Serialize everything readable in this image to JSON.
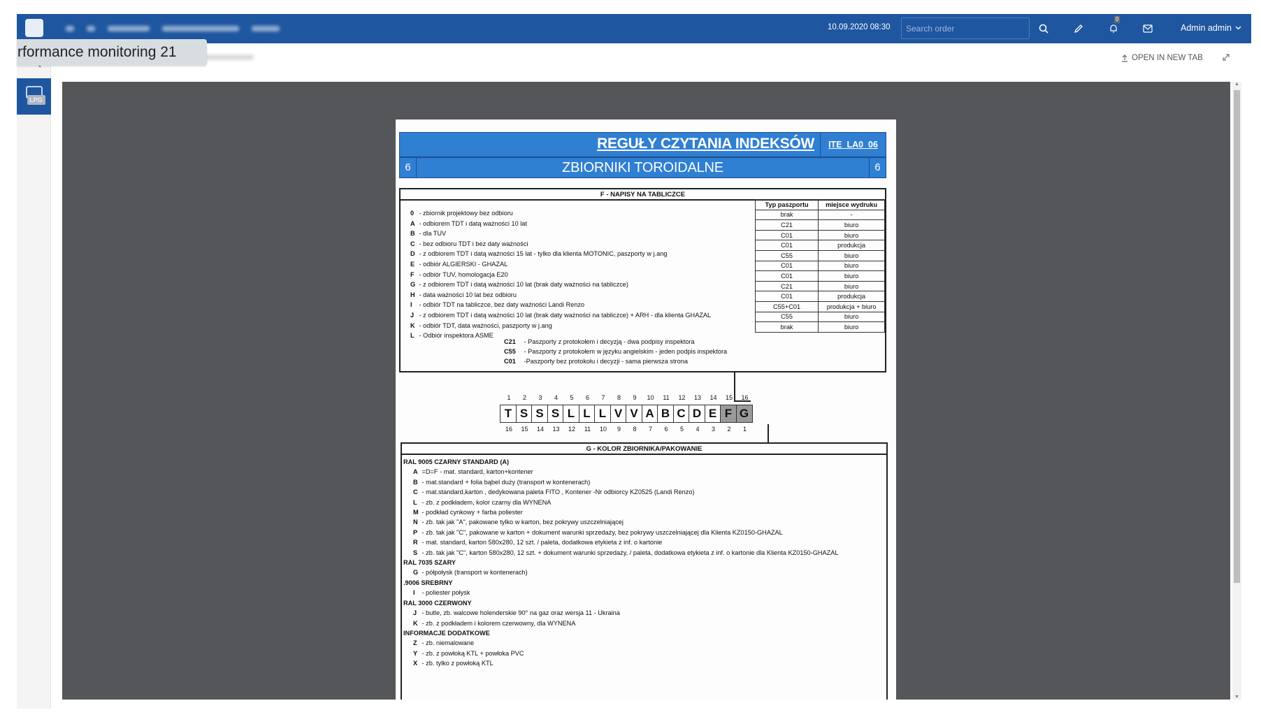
{
  "tooltip": {
    "text": "rformance monitoring 21"
  },
  "topbar": {
    "datetime": "10.09.2020 08:30",
    "search_placeholder": "Search order",
    "notification_count": "0",
    "user_name": "Admin admin",
    "icons": [
      "app-logo-icon",
      "menu-icon",
      "home-icon",
      "search-icon",
      "pencil-icon",
      "bell-icon",
      "mail-icon",
      "chevron-down-icon"
    ]
  },
  "rail": {
    "items": [
      {
        "icon": "search-icon"
      },
      {
        "icon": "lpg-device-icon",
        "label": "LPG",
        "active": true
      }
    ]
  },
  "toolbar": {
    "close_label": "CLOSE DOCUMENT",
    "open_new_tab_label": "OPEN IN NEW TAB"
  },
  "document": {
    "title": "REGUŁY CZYTANIA INDEKSÓW",
    "code": "ITE_LA0_06",
    "subtitle": "ZBIORNIKI TOROIDALNE",
    "section_number": "6",
    "section_f": {
      "title": "F - NAPISY NA TABLICZCE",
      "items": [
        {
          "key": "0",
          "text": " - zbiornik projektowy bez odbioru"
        },
        {
          "key": "A",
          "text": " -  odbiorem TDT i datą ważności 10 lat"
        },
        {
          "key": "B",
          "text": " - dla TUV"
        },
        {
          "key": "C",
          "text": " - bez odbioru TDT i bez daty ważności"
        },
        {
          "key": "D",
          "text": " - z odbiorem TDT i datą ważności 15 lat - tylko dla klienta MOTONIC, paszporty w j.ang"
        },
        {
          "key": "E",
          "text": " - odbiór ALGIERSKI - GHAZAL"
        },
        {
          "key": "F",
          "text": " - odbiór TUV, homologacja E20"
        },
        {
          "key": "G",
          "text": " - z odbiorem TDT i datą ważności 10 lat (brak daty ważności na tabliczce)"
        },
        {
          "key": "H",
          "text": " - data ważności 10 lat bez odbioru"
        },
        {
          "key": "I",
          "text": " - odbiór TDT na tabliczce, bez daty ważności Landi Renzo"
        },
        {
          "key": "J",
          "text": " - z odbiorem TDT i datą ważności 10 lat (brak daty ważności na tabliczce) + ARH - dla klienta GHAZAL"
        },
        {
          "key": "K",
          "text": " - odbiór TDT, data ważności, paszporty w j.ang"
        },
        {
          "key": "L",
          "text": " - Odbiór inspektora ASME"
        }
      ],
      "passport_table": {
        "headers": [
          "Typ paszportu",
          "miejsce wydruku"
        ],
        "rows": [
          [
            "brak",
            "-"
          ],
          [
            "C21",
            "biuro"
          ],
          [
            "C01",
            "biuro"
          ],
          [
            "C01",
            "produkcja"
          ],
          [
            "C55",
            "biuro"
          ],
          [
            "C01",
            "biuro"
          ],
          [
            "C01",
            "biuro"
          ],
          [
            "C21",
            "biuro"
          ],
          [
            "C01",
            "produkcja"
          ],
          [
            "C55+C01",
            "produkcja + biuro"
          ],
          [
            "C55",
            "biuro"
          ],
          [
            "brak",
            "biuro"
          ]
        ]
      },
      "passport_notes": [
        {
          "key": "C21",
          "text": " - Paszporty z protokołem i decyzją - dwa podpisy inspektora"
        },
        {
          "key": "C55",
          "text": " - Paszporty z protokołem w języku angielskim - jeden podpis inspektora"
        },
        {
          "key": "C01",
          "text": " -Paszporty bez protokołu i decyzji - sama pierwsza strona"
        }
      ]
    },
    "index_code": {
      "letters": [
        "T",
        "S",
        "S",
        "S",
        "L",
        "L",
        "L",
        "V",
        "V",
        "A",
        "B",
        "C",
        "D",
        "E",
        "F",
        "G"
      ],
      "top_numbers": [
        "1",
        "2",
        "3",
        "4",
        "5",
        "6",
        "7",
        "8",
        "9",
        "10",
        "11",
        "12",
        "13",
        "14",
        "15",
        "16"
      ],
      "bottom_numbers": [
        "16",
        "15",
        "14",
        "13",
        "12",
        "11",
        "10",
        "9",
        "8",
        "7",
        "6",
        "5",
        "4",
        "3",
        "2",
        "1"
      ],
      "highlighted_positions": [
        15,
        16
      ]
    },
    "section_g": {
      "title": "G - KOLOR ZBIORNIKA/PAKOWANIE",
      "groups": [
        {
          "title": "RAL 9005 CZARNY STANDARD (A)",
          "items": [
            {
              "key": "A",
              "text": " =D=F - mat. standard, karton+kontener"
            },
            {
              "key": "B",
              "text": " - mat.standard + folia bąbel duży (transport w kontenerach)"
            },
            {
              "key": "C",
              "text": " - mat.standard,karton , dedykowana paleta FITO , Kontener  -Nr odbiorcy  KZ0525 (Landi Renzo)"
            },
            {
              "key": "L",
              "text": " - zb. z podkładem, kolor czarny dla WYNENA"
            },
            {
              "key": "M",
              "text": " - podkład cynkowy + farba poliester"
            },
            {
              "key": "N",
              "text": " - zb. tak jak \"A\", pakowane tylko w karton, bez pokrywy uszczelniającej"
            },
            {
              "key": "P",
              "text": " - zb. tak jak \"C\", pakowane w karton + dokument warunki sprzedaży, bez pokrywy uszczelniającej dla Klienta KZ0150-GHAZAL"
            },
            {
              "key": "R",
              "text": " - mat. standard, karton  580x280, 12 szt. / paleta, dodatkowa etykieta z inf. o kartonie"
            },
            {
              "key": "S",
              "text": " - zb. tak jak \"C\", karton  580x280, 12 szt. + dokument warunki sprzedaży, / paleta, dodatkowa etykieta z inf. o kartonie dla Klienta KZ0150-GHAZAL"
            }
          ]
        },
        {
          "title": "RAL 7035 SZARY",
          "items": [
            {
              "key": "G",
              "text": " - półpołysk (transport w kontenerach)"
            }
          ]
        },
        {
          "title": ".9006 SREBRNY",
          "items": [
            {
              "key": "I",
              "text": " - poliester połysk"
            }
          ]
        },
        {
          "title": "RAL 3000 CZERWONY",
          "items": [
            {
              "key": "J",
              "text": " - butle, zb. walcowe holenderskie 90° na gaz oraz wersja 11 - Ukraina"
            },
            {
              "key": "K",
              "text": " - zb. z podkładem i kolorem czerwowny, dla WYNENA"
            }
          ]
        },
        {
          "title": "INFORMACJE DODATKOWE",
          "items": [
            {
              "key": "Z",
              "text": " - zb. niemalowane"
            },
            {
              "key": "Y",
              "text": " - zb. z powłoką KTL + powłoka PVC"
            },
            {
              "key": "X",
              "text": " - zb. tylko z powłoką KTL"
            }
          ]
        }
      ]
    }
  },
  "colors": {
    "topbar_bg": "#1f56a0",
    "doc_header_blue": "#2f7fd3",
    "viewer_bg": "#55565a",
    "highlight_cell": "#9a9a9a"
  }
}
